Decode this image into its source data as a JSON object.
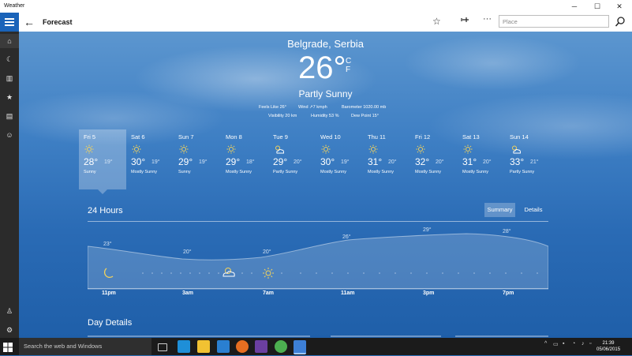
{
  "window": {
    "title": "Weather"
  },
  "appbar": {
    "page_title": "Forecast",
    "search_placeholder": "Place"
  },
  "current": {
    "location": "Belgrade, Serbia",
    "temperature": "26",
    "degree": "°",
    "unit_c": "C",
    "unit_f": "F",
    "condition": "Partly Sunny",
    "feels_like": "Feels Like  26°",
    "wind": "Wind  ↗7 kmph",
    "barometer": "Barometer  1020.00 mb",
    "visibility": "Visibility  20 km",
    "humidity": "Humidity  53 %",
    "dew_point": "Dew Point  15°"
  },
  "forecast": [
    {
      "day": "Fri 5",
      "icon": "sun-icon",
      "high": "28°",
      "low": "19°",
      "cond": "Sunny"
    },
    {
      "day": "Sat 6",
      "icon": "sun-icon",
      "high": "30°",
      "low": "19°",
      "cond": "Mostly Sunny"
    },
    {
      "day": "Sun 7",
      "icon": "sun-icon",
      "high": "29°",
      "low": "19°",
      "cond": "Sunny"
    },
    {
      "day": "Mon 8",
      "icon": "sun-icon",
      "high": "29°",
      "low": "18°",
      "cond": "Mostly Sunny"
    },
    {
      "day": "Tue 9",
      "icon": "partly-sunny-icon",
      "high": "29°",
      "low": "20°",
      "cond": "Partly Sunny"
    },
    {
      "day": "Wed 10",
      "icon": "sun-icon",
      "high": "30°",
      "low": "19°",
      "cond": "Mostly Sunny"
    },
    {
      "day": "Thu 11",
      "icon": "sun-icon",
      "high": "31°",
      "low": "20°",
      "cond": "Mostly Sunny"
    },
    {
      "day": "Fri 12",
      "icon": "sun-icon",
      "high": "32°",
      "low": "20°",
      "cond": "Mostly Sunny"
    },
    {
      "day": "Sat 13",
      "icon": "sun-icon",
      "high": "31°",
      "low": "20°",
      "cond": "Mostly Sunny"
    },
    {
      "day": "Sun 14",
      "icon": "partly-sunny-icon",
      "high": "33°",
      "low": "21°",
      "cond": "Partly Sunny"
    }
  ],
  "hours24": {
    "title": "24 Hours",
    "tabs": [
      "Summary",
      "Details"
    ],
    "temps": [
      "23°",
      "20°",
      "20°",
      "26°",
      "29°",
      "28°"
    ],
    "times": [
      "11pm",
      "3am",
      "7am",
      "11am",
      "3pm",
      "7pm"
    ]
  },
  "day_details": {
    "title": "Day Details"
  },
  "taskbar": {
    "search": "Search the web and Windows",
    "time": "21:39",
    "date": "05/06/2015"
  },
  "colors": {
    "accent": "#1a63b9",
    "sidebar": "#2b2b2b",
    "taskbar": "#1b1b1b"
  }
}
